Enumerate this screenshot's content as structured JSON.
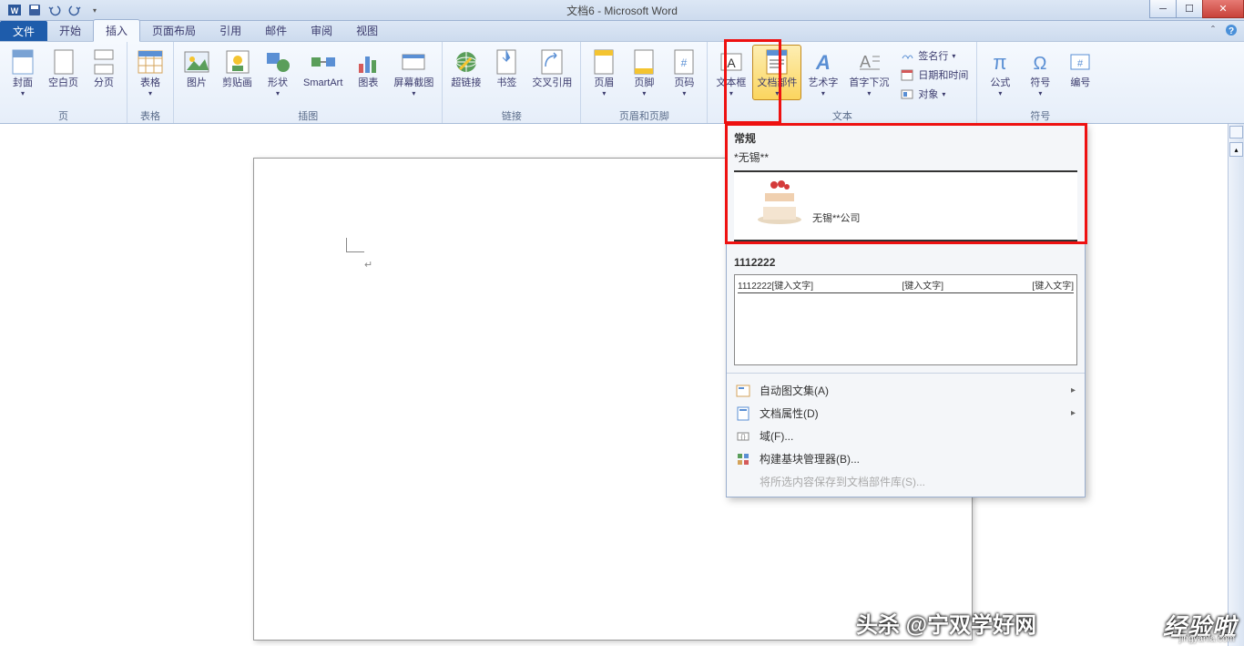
{
  "title": "文档6 - Microsoft Word",
  "tabs": {
    "file": "文件",
    "home": "开始",
    "insert": "插入",
    "layout": "页面布局",
    "ref": "引用",
    "mail": "邮件",
    "review": "审阅",
    "view": "视图"
  },
  "ribbon": {
    "pages": {
      "cover": "封面",
      "blank": "空白页",
      "break": "分页",
      "label": "页"
    },
    "tables": {
      "table": "表格",
      "label": "表格"
    },
    "illus": {
      "pic": "图片",
      "clip": "剪贴画",
      "shape": "形状",
      "smart": "SmartArt",
      "chart": "图表",
      "screenshot": "屏幕截图",
      "label": "插图"
    },
    "links": {
      "hyper": "超链接",
      "bookmark": "书签",
      "cross": "交叉引用",
      "label": "链接"
    },
    "headfoot": {
      "header": "页眉",
      "footer": "页脚",
      "pagenum": "页码",
      "label": "页眉和页脚"
    },
    "text": {
      "textbox": "文本框",
      "parts": "文档部件",
      "wordart": "艺术字",
      "dropcap": "首字下沉",
      "sig": "签名行",
      "datetime": "日期和时间",
      "object": "对象",
      "label": "文本"
    },
    "symbols": {
      "eq": "公式",
      "sym": "符号",
      "num": "编号",
      "label": "符号"
    }
  },
  "dropdown": {
    "section1": "常规",
    "item1_title": "*无锡**",
    "item1_text": "无锡**公司",
    "item2_title": "1112222",
    "item2_col1": "1112222[键入文字]",
    "item2_col2": "[键入文字]",
    "item2_col3": "[键入文字]",
    "menu": {
      "autotext": "自动图文集(A)",
      "docprop": "文档属性(D)",
      "field": "域(F)...",
      "bbmgr": "构建基块管理器(B)...",
      "save": "将所选内容保存到文档部件库(S)..."
    }
  },
  "watermark": {
    "left": "头杀 @宁双学好网",
    "right": "经验啦",
    "url": "jingyanla.com"
  }
}
